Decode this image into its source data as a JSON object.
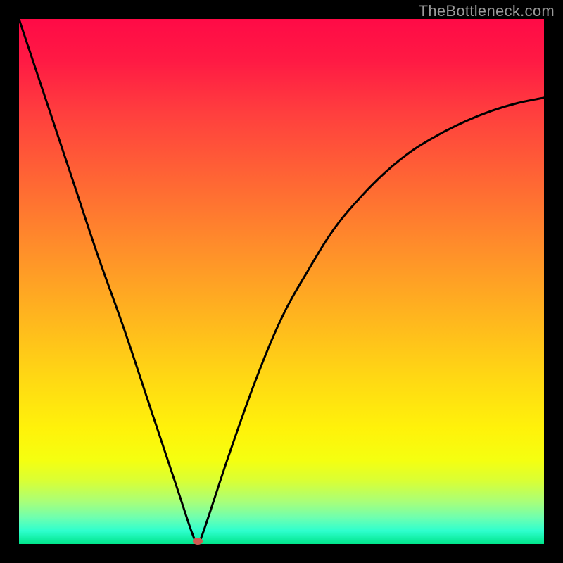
{
  "watermark": "TheBottleneck.com",
  "chart_data": {
    "type": "line",
    "title": "",
    "xlabel": "",
    "ylabel": "",
    "xlim": [
      0,
      100
    ],
    "ylim": [
      0,
      100
    ],
    "grid": false,
    "series": [
      {
        "name": "bottleneck-curve",
        "x": [
          0,
          5,
          10,
          15,
          20,
          25,
          30,
          33,
          34,
          35,
          40,
          45,
          50,
          55,
          60,
          65,
          70,
          75,
          80,
          85,
          90,
          95,
          100
        ],
        "y": [
          100,
          85,
          70,
          55,
          41,
          26,
          11,
          2,
          0.5,
          2,
          17,
          31,
          43,
          52,
          60,
          66,
          71,
          75,
          78,
          80.5,
          82.5,
          84,
          85
        ]
      }
    ],
    "marker": {
      "x": 34,
      "y": 0.5,
      "color": "#d25a52"
    },
    "gradient_stops": [
      {
        "pos": 0.0,
        "color": "#ff0a46"
      },
      {
        "pos": 0.78,
        "color": "#fff20a"
      },
      {
        "pos": 1.0,
        "color": "#00e58a"
      }
    ]
  }
}
